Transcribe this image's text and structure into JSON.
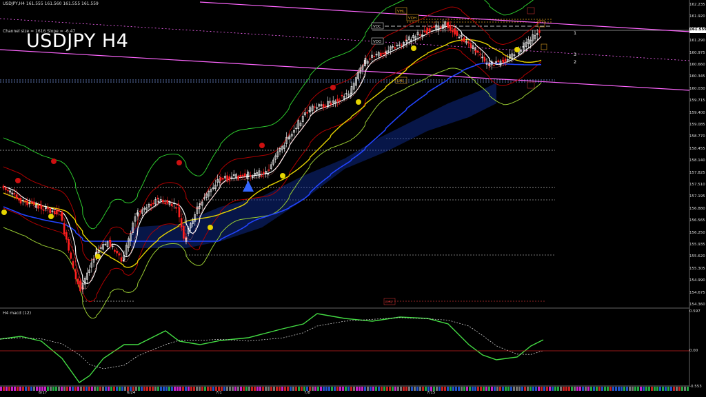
{
  "header": {
    "quote": "USDJPY,H4  161.555  161.560  161.555  161.559",
    "channel_info": "Channel size = 1616  Slope = -6.47",
    "symbol_title": "USDJPY H4"
  },
  "price_axis": [
    "162.235",
    "161.920",
    "161.605",
    "161.290",
    "160.975",
    "160.660",
    "160.345",
    "160.030",
    "159.715",
    "159.400",
    "159.085",
    "158.770",
    "158.455",
    "158.140",
    "157.825",
    "157.510",
    "157.195",
    "156.880",
    "156.565",
    "156.250",
    "155.935",
    "155.620",
    "155.305",
    "154.990",
    "154.675",
    "154.360"
  ],
  "current_price": "161.559",
  "indicator": {
    "label": "H4  macd (12)",
    "scale_top": "0.597",
    "scale_zero": "0.00",
    "scale_bottom": "-0.553"
  },
  "time_axis": [
    "6/17",
    "6/24",
    "7/1",
    "7/8",
    "7/15"
  ],
  "level_tags": {
    "vdc1": "VDC",
    "vdo": "VDO",
    "vdh": "VDH",
    "vhl": "VHL",
    "lhl": "LHL",
    "lhl2": "LHL"
  },
  "channel_labels": [
    "1",
    "2",
    "3"
  ],
  "colors": {
    "background": "#000000",
    "bull_candle": "#ffffff",
    "bear_candle": "#ff2020",
    "channel": "#ff66ff",
    "ema_slow": "#2244ff",
    "ema_mid": "#e6d400",
    "ema_fast": "#ffffff",
    "envelope": "#2ecc2e",
    "bollinger": "#b00000",
    "macd": "#44dd44",
    "signal": "#cccccc"
  }
}
